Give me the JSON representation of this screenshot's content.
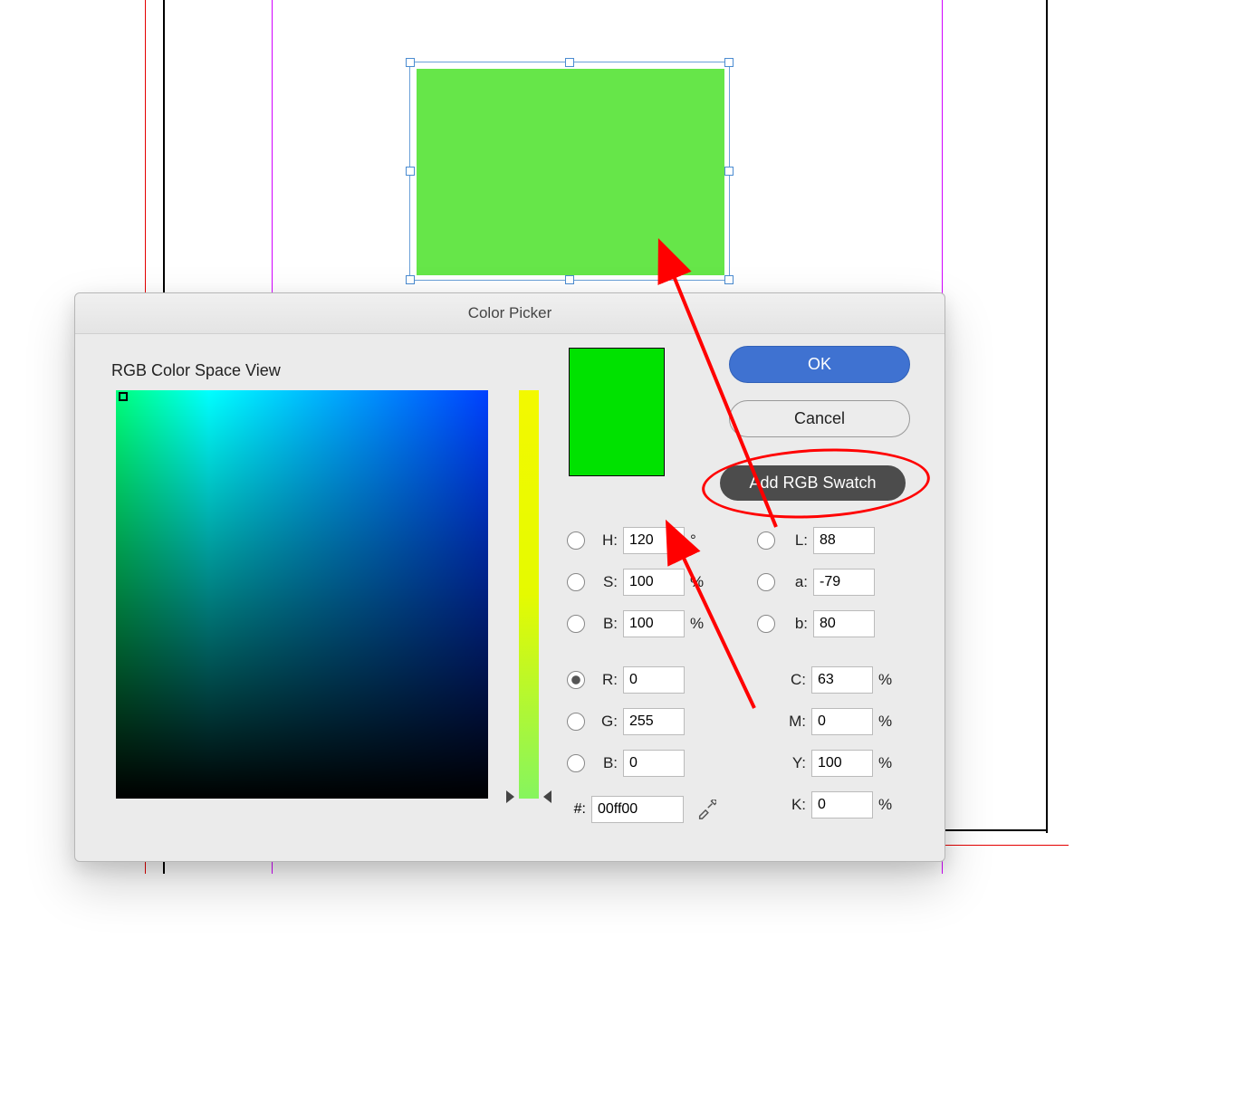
{
  "dialog": {
    "title": "Color Picker",
    "space_label": "RGB Color Space View",
    "buttons": {
      "ok": "OK",
      "cancel": "Cancel",
      "add_swatch": "Add RGB Swatch"
    },
    "preview_color": "#00e200",
    "selected_shape_color": "#66e649",
    "hsb": {
      "h_label": "H:",
      "h": "120",
      "h_unit": "°",
      "s_label": "S:",
      "s": "100",
      "s_unit": "%",
      "b_label": "B:",
      "b": "100",
      "b_unit": "%"
    },
    "lab": {
      "l_label": "L:",
      "l": "88",
      "a_label": "a:",
      "a": "-79",
      "b_label": "b:",
      "b": "80"
    },
    "rgb": {
      "r_label": "R:",
      "r": "0",
      "g_label": "G:",
      "g": "255",
      "b_label": "B:",
      "b": "0"
    },
    "cmyk": {
      "c_label": "C:",
      "c": "63",
      "m_label": "M:",
      "m": "0",
      "y_label": "Y:",
      "y": "100",
      "k_label": "K:",
      "k": "0",
      "unit": "%"
    },
    "hex_label": "#:",
    "hex": "00ff00"
  }
}
